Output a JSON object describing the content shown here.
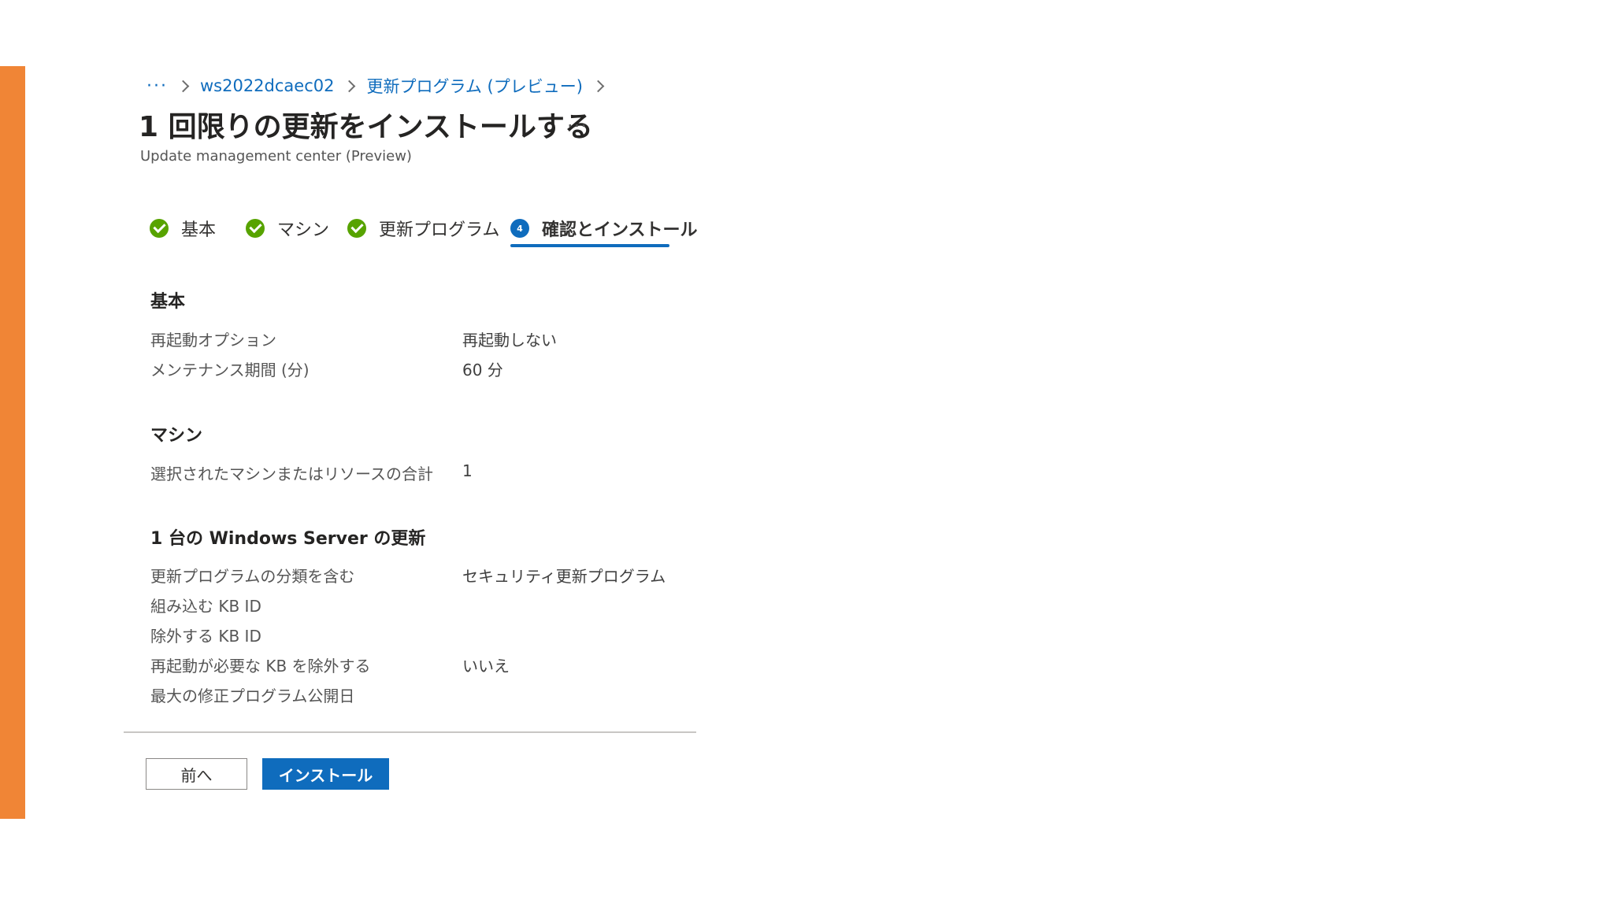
{
  "breadcrumb": {
    "ellipsis": "···",
    "items": [
      "ws2022dcaec02",
      "更新プログラム (プレビュー)"
    ]
  },
  "header": {
    "title": "1 回限りの更新をインストールする",
    "more": "···",
    "subtitle": "Update management center (Preview)"
  },
  "tabs": [
    {
      "label": "基本",
      "state": "complete"
    },
    {
      "label": "マシン",
      "state": "complete"
    },
    {
      "label": "更新プログラム",
      "state": "complete"
    },
    {
      "label": "確認とインストール",
      "state": "active",
      "step": "4"
    }
  ],
  "sections": {
    "basics": {
      "title": "基本",
      "rows": [
        {
          "label": "再起動オプション",
          "value": "再起動しない"
        },
        {
          "label": "メンテナンス期間 (分)",
          "value": "60 分"
        }
      ]
    },
    "machines": {
      "title": "マシン",
      "rows": [
        {
          "label": "選択されたマシンまたはリソースの合計",
          "value": "1"
        }
      ]
    },
    "updates": {
      "title": "1 台の Windows Server の更新",
      "rows": [
        {
          "label": "更新プログラムの分類を含む",
          "value": "セキュリティ更新プログラム"
        },
        {
          "label": "組み込む KB ID",
          "value": ""
        },
        {
          "label": "除外する KB ID",
          "value": ""
        },
        {
          "label": "再起動が必要な KB を除外する",
          "value": "いいえ"
        },
        {
          "label": "最大の修正プログラム公開日",
          "value": ""
        }
      ]
    }
  },
  "buttons": {
    "previous": "前へ",
    "install": "インストール"
  },
  "colors": {
    "accent_bar": "#f08536",
    "primary": "#0f6cbd",
    "success": "#57a300"
  }
}
